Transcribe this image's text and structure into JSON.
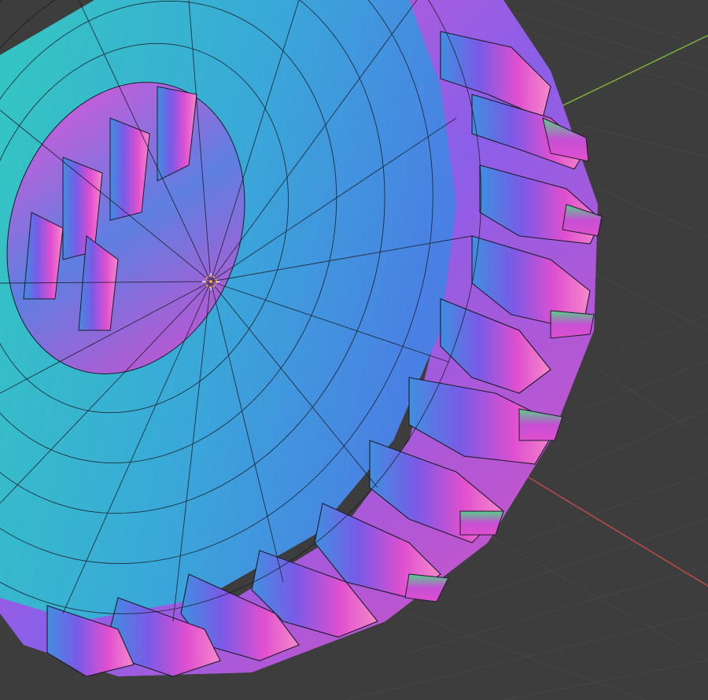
{
  "viewport": {
    "background_color": "#3d3d3d",
    "grid_color": "#4a4a4a",
    "x_axis_color": "#c04a4a",
    "y_axis_color": "#7bb33a",
    "shading_mode": "normal-map-matcap",
    "overlay": "wireframe"
  },
  "object": {
    "type": "tire",
    "palette": {
      "cyan": "#2fc2c4",
      "blue": "#3f8fe0",
      "teal": "#2bb7a8",
      "magenta": "#e04fcf",
      "purple": "#7a5ae6",
      "pink": "#f05fb6"
    }
  },
  "gizmo": {
    "name": "object-origin",
    "color": "#f3a33a"
  }
}
